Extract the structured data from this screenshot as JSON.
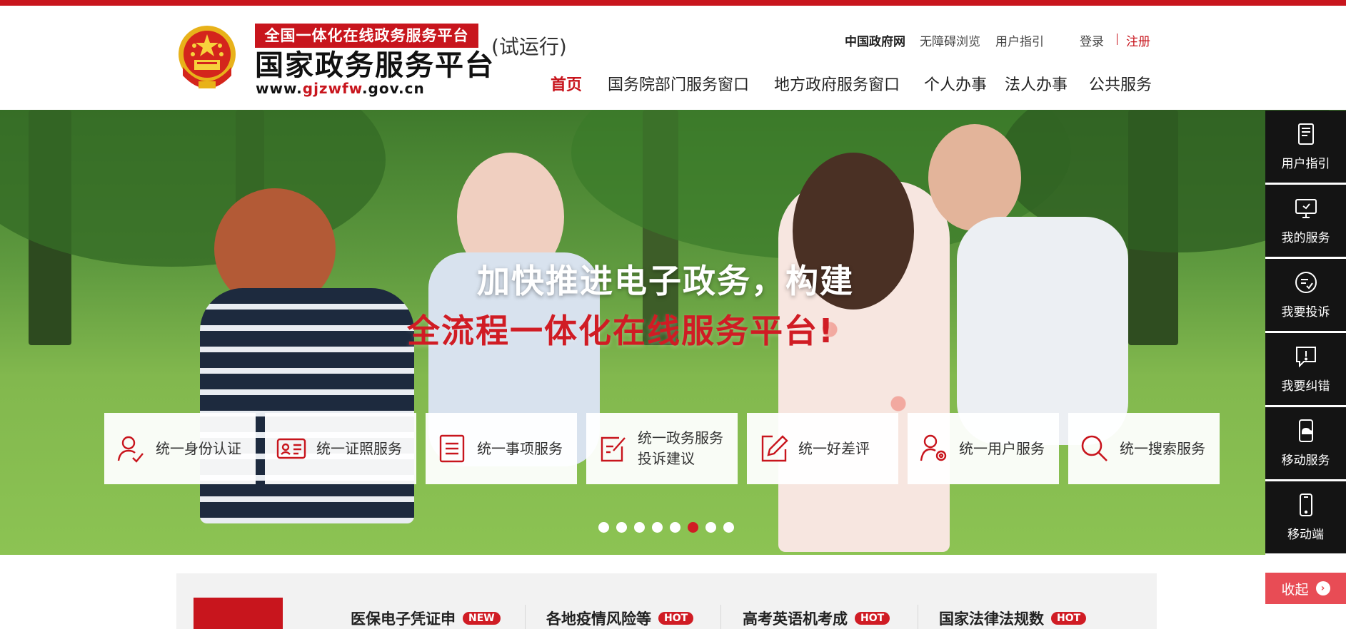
{
  "header": {
    "logo_badge": "全国一体化在线政务服务平台",
    "logo_title": "国家政务服务平台",
    "logo_url_prefix": "www.",
    "logo_url_highlight": "gjzwfw",
    "logo_url_suffix": ".gov.cn",
    "trial_label": "(试运行)",
    "util_links": {
      "gov": "中国政府网",
      "accessible": "无障碍浏览",
      "guide": "用户指引",
      "login": "登录",
      "register": "注册"
    },
    "nav": [
      "首页",
      "国务院部门服务窗口",
      "地方政府服务窗口",
      "个人办事",
      "法人办事",
      "公共服务"
    ]
  },
  "hero": {
    "slogan_line1": "加快推进电子政务，构建",
    "slogan_line2": "全流程一体化在线服务平台!",
    "services": [
      {
        "label": "统一身份认证",
        "icon": "person-check-icon"
      },
      {
        "label": "统一证照服务",
        "icon": "id-card-icon"
      },
      {
        "label": "统一事项服务",
        "icon": "document-list-icon"
      },
      {
        "label": "统一政务服务\n投诉建议",
        "icon": "edit-note-icon"
      },
      {
        "label": "统一好差评",
        "icon": "pencil-icon"
      },
      {
        "label": "统一用户服务",
        "icon": "user-gear-icon"
      },
      {
        "label": "统一搜索服务",
        "icon": "search-icon"
      }
    ],
    "carousel_total": 8,
    "carousel_active": 6
  },
  "sidebar": {
    "items": [
      {
        "label": "用户指引",
        "icon": "guide-book-icon"
      },
      {
        "label": "我的服务",
        "icon": "monitor-icon"
      },
      {
        "label": "我要投诉",
        "icon": "complaint-check-icon"
      },
      {
        "label": "我要纠错",
        "icon": "alert-message-icon"
      },
      {
        "label": "移动服务",
        "icon": "mobile-cloud-icon"
      },
      {
        "label": "移动端",
        "icon": "mobile-icon"
      }
    ],
    "collapse_label": "收起"
  },
  "news": [
    {
      "title": "医保电子凭证申",
      "badge": "NEW"
    },
    {
      "title": "各地疫情风险等",
      "badge": "HOT"
    },
    {
      "title": "高考英语机考成",
      "badge": "HOT"
    },
    {
      "title": "国家法律法规数",
      "badge": "HOT"
    }
  ],
  "colors": {
    "brand_red": "#c8151d",
    "sidebar_bg": "#141414",
    "collapse_bg": "#e84c55"
  }
}
